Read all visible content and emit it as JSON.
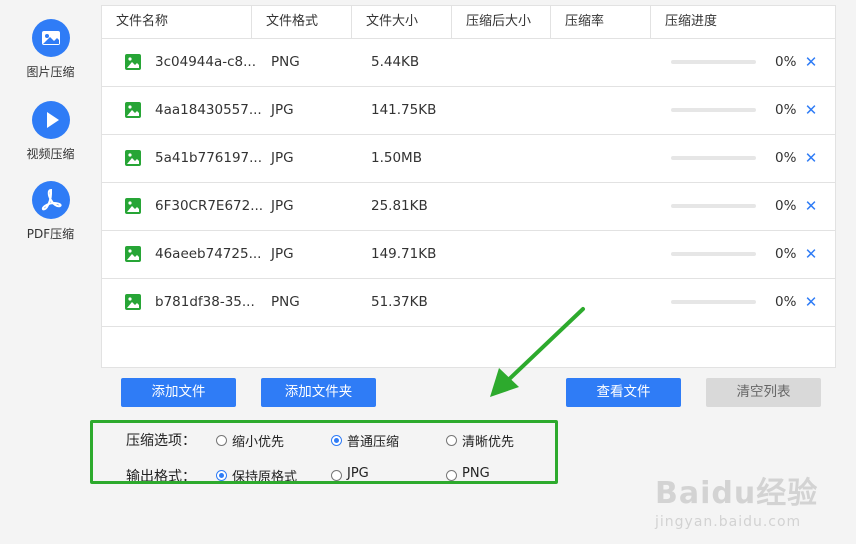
{
  "sidebar": {
    "items": [
      {
        "label": "图片压缩",
        "icon": "image-icon"
      },
      {
        "label": "视频压缩",
        "icon": "play-icon"
      },
      {
        "label": "PDF压缩",
        "icon": "pdf-icon"
      }
    ]
  },
  "table": {
    "columns": [
      "文件名称",
      "文件格式",
      "文件大小",
      "压缩后大小",
      "压缩率",
      "压缩进度"
    ],
    "rows": [
      {
        "name": "3c04944a-c8...",
        "format": "PNG",
        "size": "5.44KB",
        "compressed_size": "",
        "ratio": "",
        "progress_text": "0%",
        "progress": 0
      },
      {
        "name": "4aa18430557...",
        "format": "JPG",
        "size": "141.75KB",
        "compressed_size": "",
        "ratio": "",
        "progress_text": "0%",
        "progress": 0
      },
      {
        "name": "5a41b776197...",
        "format": "JPG",
        "size": "1.50MB",
        "compressed_size": "",
        "ratio": "",
        "progress_text": "0%",
        "progress": 0
      },
      {
        "name": "6F30CR7E672...",
        "format": "JPG",
        "size": "25.81KB",
        "compressed_size": "",
        "ratio": "",
        "progress_text": "0%",
        "progress": 0
      },
      {
        "name": "46aeeb74725...",
        "format": "JPG",
        "size": "149.71KB",
        "compressed_size": "",
        "ratio": "",
        "progress_text": "0%",
        "progress": 0
      },
      {
        "name": "b781df38-35...",
        "format": "PNG",
        "size": "51.37KB",
        "compressed_size": "",
        "ratio": "",
        "progress_text": "0%",
        "progress": 0
      }
    ]
  },
  "buttons": {
    "add_file": "添加文件",
    "add_folder": "添加文件夹",
    "view_files": "查看文件",
    "clear_list": "清空列表"
  },
  "options": {
    "compress_title": "压缩选项：",
    "compress_choices": [
      {
        "label": "缩小优先",
        "checked": false
      },
      {
        "label": "普通压缩",
        "checked": true
      },
      {
        "label": "清晰优先",
        "checked": false
      }
    ],
    "output_title": "输出格式：",
    "output_choices": [
      {
        "label": "保持原格式",
        "checked": true
      },
      {
        "label": "JPG",
        "checked": false
      },
      {
        "label": "PNG",
        "checked": false
      }
    ]
  },
  "watermark": {
    "brand": "Baidu经验",
    "url": "jingyan.baidu.com"
  },
  "colors": {
    "accent": "#2f7cf6",
    "highlight": "#2daa2d",
    "file_icon": "#27a536"
  }
}
